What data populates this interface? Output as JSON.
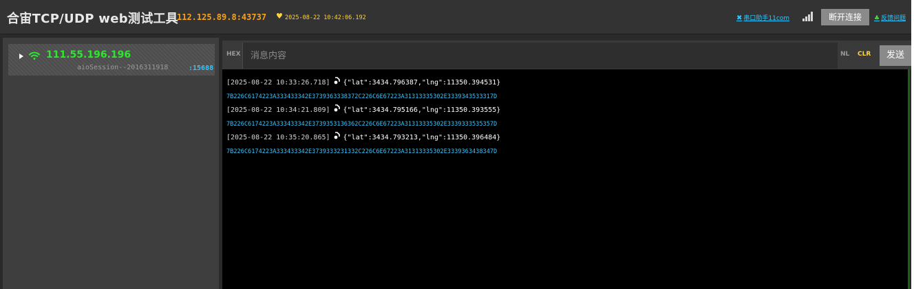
{
  "header": {
    "title": "合宙TCP/UDP web测试工具",
    "address": "112.125.89.8:43737",
    "heart_icon": "heart-icon",
    "timestamp": "2025-08-22 10:42:06.192",
    "serial_link": "串口助手11com",
    "signal_icon": "signal-bars-icon",
    "disconnect_label": "断开连接",
    "feedback_link": "反馈问题"
  },
  "sidebar": {
    "session": {
      "ip": "111.55.196.196",
      "id": "aioSession--2016311918",
      "port": ":15688",
      "icon": "wifi-icon"
    }
  },
  "message_bar": {
    "hex_label": "HEX",
    "placeholder": "消息内容",
    "value": "",
    "nl_label": "NL",
    "clr_label": "CLR",
    "send_label": "发送"
  },
  "log": {
    "entries": [
      {
        "time": "[2025-08-22 10:33:26.718]",
        "text": "{\"lat\":3434.796387,\"lng\":11350.394531}",
        "hex": "7B226C6174223A333433342E3739363338372C226C6E67223A31313335302E3339343533317D"
      },
      {
        "time": "[2025-08-22 10:34:21.809]",
        "text": "{\"lat\":3434.795166,\"lng\":11350.393555}",
        "hex": "7B226C6174223A333433342E3739353136362C226C6E67223A31313335302E3339333535357D"
      },
      {
        "time": "[2025-08-22 10:35:20.865]",
        "text": "{\"lat\":3434.793213,\"lng\":11350.396484}",
        "hex": "7B226C6174223A333433342E3739333231332C226C6E67223A31313335302E3339363438347D"
      }
    ]
  },
  "colors": {
    "accent_green": "#2ee62e",
    "accent_cyan": "#33c5ff",
    "accent_orange": "#f7a21b",
    "accent_yellow": "#ffd43b"
  }
}
